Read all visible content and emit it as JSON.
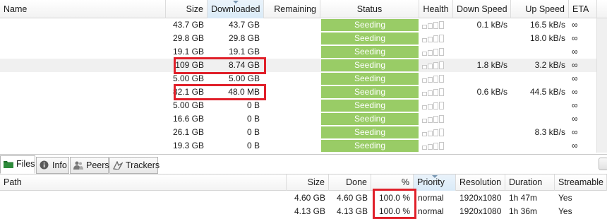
{
  "torrents": {
    "columns": {
      "name": "Name",
      "size": "Size",
      "downloaded": "Downloaded",
      "remaining": "Remaining",
      "status": "Status",
      "health": "Health",
      "down_speed": "Down Speed",
      "up_speed": "Up Speed",
      "eta": "ETA"
    },
    "rows": [
      {
        "size": "43.7 GB",
        "downloaded": "43.7 GB",
        "status": "Seeding",
        "down": "0.1 kB/s",
        "up": "16.5 kB/s",
        "eta": "∞"
      },
      {
        "size": "29.8 GB",
        "downloaded": "29.8 GB",
        "status": "Seeding",
        "down": "",
        "up": "18.0 kB/s",
        "eta": "∞"
      },
      {
        "size": "19.1 GB",
        "downloaded": "19.1 GB",
        "status": "Seeding",
        "down": "",
        "up": "",
        "eta": "∞"
      },
      {
        "size": "109 GB",
        "downloaded": "8.74 GB",
        "status": "Seeding",
        "down": "1.8 kB/s",
        "up": "3.2 kB/s",
        "eta": "∞"
      },
      {
        "size": "5.00 GB",
        "downloaded": "5.00 GB",
        "status": "Seeding",
        "down": "",
        "up": "",
        "eta": "∞"
      },
      {
        "size": "82.1 GB",
        "downloaded": "48.0 MB",
        "status": "Seeding",
        "down": "0.6 kB/s",
        "up": "44.5 kB/s",
        "eta": "∞"
      },
      {
        "size": "5.00 GB",
        "downloaded": "0 B",
        "status": "Seeding",
        "down": "",
        "up": "",
        "eta": "∞"
      },
      {
        "size": "16.6 GB",
        "downloaded": "0 B",
        "status": "Seeding",
        "down": "",
        "up": "",
        "eta": "∞"
      },
      {
        "size": "26.1 GB",
        "downloaded": "0 B",
        "status": "Seeding",
        "down": "",
        "up": "8.3 kB/s",
        "eta": "∞"
      },
      {
        "size": "19.3 GB",
        "downloaded": "0 B",
        "status": "Seeding",
        "down": "",
        "up": "",
        "eta": "∞"
      }
    ]
  },
  "tabs": [
    {
      "label": "Files",
      "icon": "folder-icon",
      "active": true
    },
    {
      "label": "Info",
      "icon": "info-icon",
      "active": false
    },
    {
      "label": "Peers",
      "icon": "peers-icon",
      "active": false
    },
    {
      "label": "Trackers",
      "icon": "trackers-icon",
      "active": false
    }
  ],
  "files": {
    "columns": {
      "path": "Path",
      "size": "Size",
      "done": "Done",
      "percent": "%",
      "priority": "Priority",
      "resolution": "Resolution",
      "duration": "Duration",
      "streamable": "Streamable"
    },
    "rows": [
      {
        "size": "4.60 GB",
        "done": "4.60 GB",
        "percent": "100.0 %",
        "priority": "normal",
        "resolution": "1920x1080",
        "duration": "1h 47m",
        "streamable": "Yes"
      },
      {
        "size": "4.13 GB",
        "done": "4.13 GB",
        "percent": "100.0 %",
        "priority": "normal",
        "resolution": "1920x1080",
        "duration": "1h 36m",
        "streamable": "Yes"
      }
    ]
  },
  "colors": {
    "status_seeding": "#99cc66",
    "highlight_box": "#e0202a",
    "sorted_header": "#d9eaf7"
  }
}
